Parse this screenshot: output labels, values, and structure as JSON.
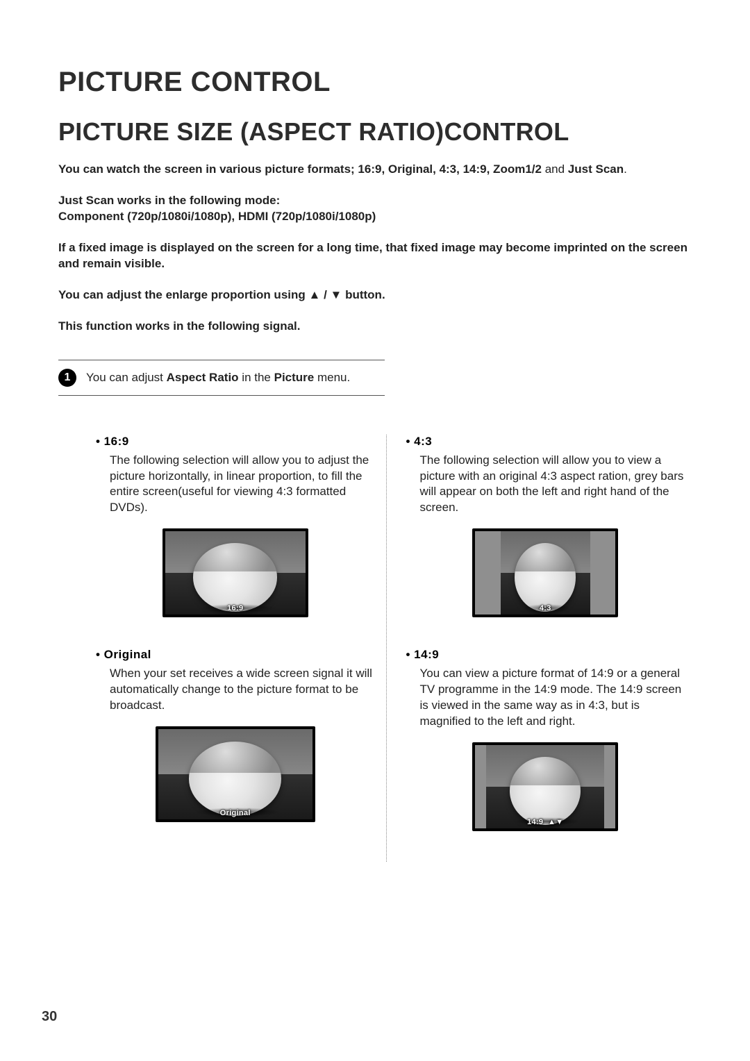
{
  "page": {
    "number": "30"
  },
  "header": {
    "chapter": "PICTURE CONTROL",
    "section": "PICTURE SIZE (ASPECT RATIO)CONTROL"
  },
  "intro": {
    "formats_pre": "You can watch the screen in various picture formats; ",
    "formats_list": "16:9,  Original, 4:3, 14:9, Zoom1/2",
    "formats_and": " and ",
    "formats_last": "Just Scan",
    "justscan_l1": "Just Scan works in the following mode:",
    "justscan_l2": "Component (720p/1080i/1080p), HDMI (720p/1080i/1080p)",
    "burn_in": "If a fixed image is displayed on the screen for a long time, that fixed image may become imprinted on the screen and remain visible.",
    "arrows_pre": "You can adjust the enlarge proportion using ",
    "arrows_post": " button.",
    "signal": "This function works in the following signal."
  },
  "step": {
    "num": "1",
    "pre": "You can adjust ",
    "aspect": "Aspect Ratio",
    "mid": " in the ",
    "menu": "Picture",
    "post": " menu."
  },
  "modes": [
    {
      "title": "• 16:9",
      "body": "The following selection will allow you to adjust the picture horizontally, in linear proportion, to fill the entire screen(useful for viewing 4:3 formatted DVDs).",
      "label": "16:9"
    },
    {
      "title": "• Original",
      "body": "When your set receives a wide screen signal it will automatically change to the picture format to be broadcast.",
      "label": "Original"
    },
    {
      "title": "• 4:3",
      "body": "The following selection will allow you to view a picture with an original 4:3 aspect ration, grey bars will appear on both the left and right hand of the screen.",
      "label": "4:3"
    },
    {
      "title": "• 14:9",
      "body": "You can view a picture format of 14:9 or a general TV programme in the 14:9 mode. The 14:9 screen is viewed in the same way as in 4:3, but is magnified to the left and right.",
      "label": "14:9"
    }
  ]
}
